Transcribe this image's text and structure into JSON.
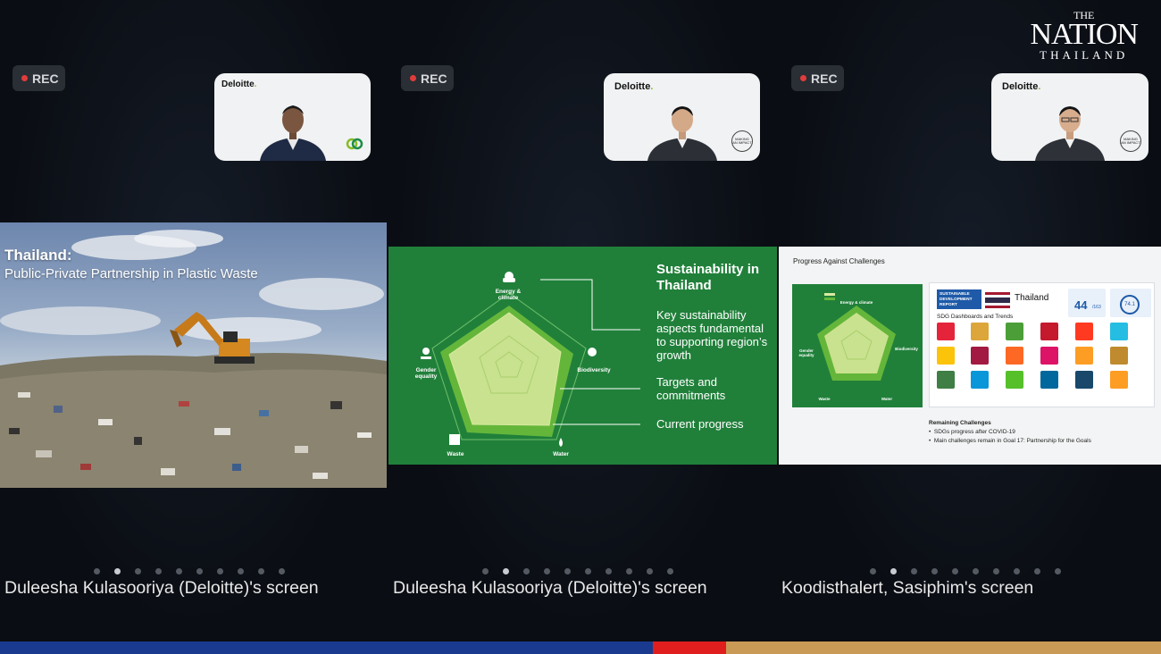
{
  "panels": [
    {
      "rec_label": "REC",
      "cam_brand": "Deloitte",
      "screen_label": "Duleesha Kulasooriya (Deloitte)'s screen",
      "slide": {
        "title": "Thailand:",
        "subtitle": "Public-Private Partnership in Plastic Waste"
      },
      "pager_active": 1,
      "pager_count": 10
    },
    {
      "rec_label": "REC",
      "cam_brand": "Deloitte",
      "screen_label": "Duleesha Kulasooriya (Deloitte)'s screen",
      "slide": {
        "title": "Sustainability in Thailand",
        "point1": "Key sustainability aspects fundamental to supporting region’s growth",
        "point2": "Targets and commitments",
        "point3": "Current progress",
        "axes": [
          "Energy & climate",
          "Biodiversity",
          "Water",
          "Waste",
          "Gender equality"
        ]
      },
      "pager_active": 1,
      "pager_count": 10
    },
    {
      "rec_label": "REC",
      "cam_brand": "Deloitte",
      "screen_label": "Koodisthalert, Sasiphim's screen",
      "slide": {
        "header": "Progress Against Challenges",
        "report_title": "SUSTAINABLE DEVELOPMENT REPORT",
        "country": "Thailand",
        "dashboards": "SDG Dashboards and Trends",
        "rank_value": "44",
        "rank_of": "/163",
        "score_value": "74.1",
        "remaining_title": "Remaining Challenges",
        "remaining_items": [
          "SDGs progress after COVID-19",
          "Main challenges remain in Goal 17: Partnership for the Goals"
        ],
        "mini_axes": [
          "Energy & climate",
          "Biodiversity",
          "Water",
          "Waste",
          "Gender equality"
        ]
      },
      "pager_active": 1,
      "pager_count": 10
    }
  ],
  "watermark": {
    "line1": "THE",
    "line2": "NATION",
    "line3": "THAILAND"
  },
  "colors": {
    "deloitte_green": "#86bc25",
    "slide_green": "#20803a",
    "bar_blue": "#1a3a8f",
    "bar_red": "#e01e1e",
    "bar_gold": "#c99a55"
  }
}
